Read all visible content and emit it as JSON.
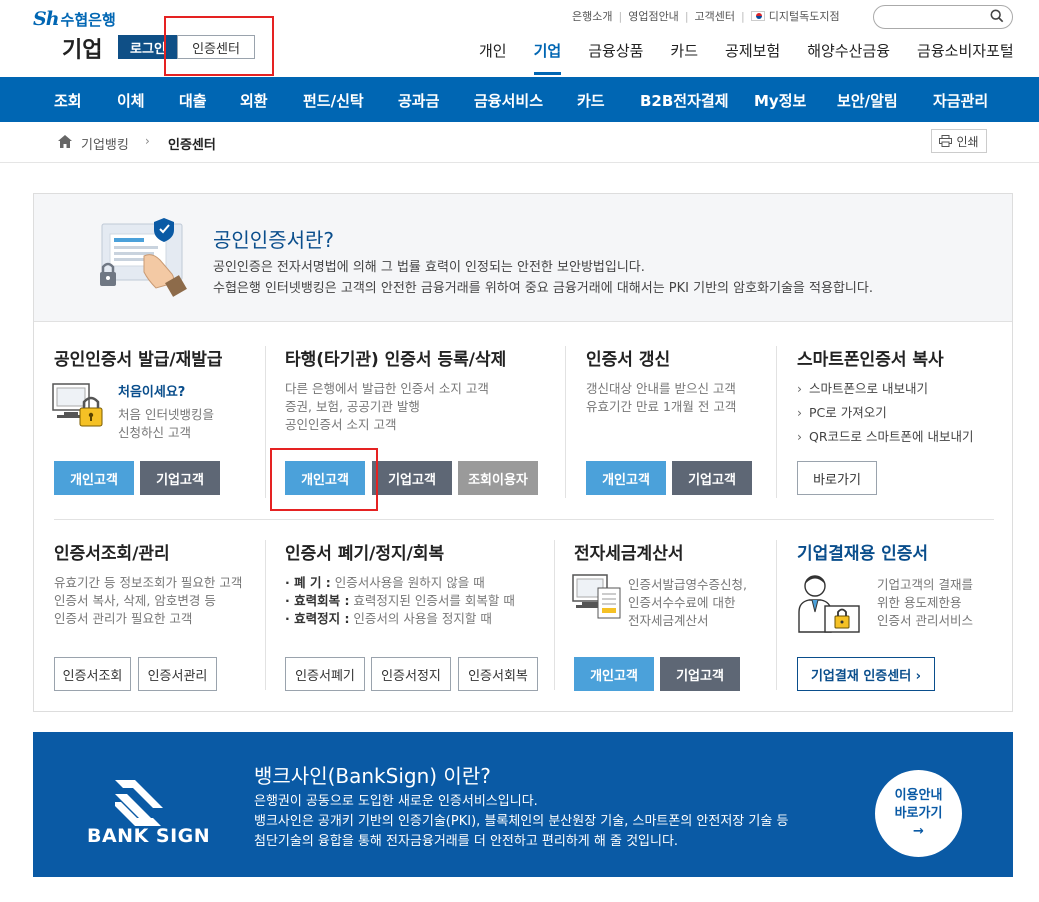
{
  "header": {
    "logo_sh": "Sh",
    "logo_name": "수협은행",
    "section": "기업",
    "login_label": "로그인",
    "cert_center_label": "인증센터",
    "util_links": [
      "은행소개",
      "영업점안내",
      "고객센터",
      "디지털독도지점"
    ],
    "search_placeholder": "",
    "gnb": [
      "개인",
      "기업",
      "금융상품",
      "카드",
      "공제보험",
      "해양수산금융",
      "금융소비자포털"
    ],
    "gnb_active": "기업"
  },
  "subnav": [
    "조회",
    "이체",
    "대출",
    "외환",
    "펀드/신탁",
    "공과금",
    "금융서비스",
    "카드",
    "B2B전자결제",
    "My정보",
    "보안/알림",
    "자금관리"
  ],
  "breadcrumb": {
    "home": "기업뱅킹",
    "current": "인증센터",
    "print_label": "인쇄"
  },
  "intro": {
    "title": "공인인증서란?",
    "line1": "공인인증은 전자서명법에 의해 그 법률 효력이 인정되는 안전한 보안방법입니다.",
    "line2": "수협은행 인터넷뱅킹은 고객의 안전한 금융거래를 위하여 중요 금융거래에 대해서는 PKI 기반의 암호화기술을 적용합니다."
  },
  "sections": {
    "issue": {
      "title": "공인인증서 발급/재발급",
      "first_time": "처음이세요?",
      "desc1": "처음 인터넷뱅킹을",
      "desc2": "신청하신 고객",
      "btn_personal": "개인고객",
      "btn_corp": "기업고객"
    },
    "other_bank": {
      "title": "타행(타기관) 인증서 등록/삭제",
      "desc1": "다른 은행에서 발급한 인증서 소지 고객",
      "desc2": "증권, 보험, 공공기관 발행",
      "desc3": "공인인증서 소지 고객",
      "btn_personal": "개인고객",
      "btn_corp": "기업고객",
      "btn_inquiry": "조회이용자"
    },
    "renew": {
      "title": "인증서 갱신",
      "desc1": "갱신대상 안내를 받으신 고객",
      "desc2": "유효기간 만료 1개월 전 고객",
      "btn_personal": "개인고객",
      "btn_corp": "기업고객"
    },
    "smartphone": {
      "title": "스마트폰인증서 복사",
      "items": [
        "스마트폰으로 내보내기",
        "PC로 가져오기",
        "QR코드로 스마트폰에 내보내기"
      ],
      "btn_go": "바로가기"
    },
    "manage": {
      "title": "인증서조회/관리",
      "desc1": "유효기간 등 정보조회가 필요한 고객",
      "desc2": "인증서 복사, 삭제, 암호변경 등",
      "desc3": "인증서 관리가 필요한 고객",
      "btn_inquiry": "인증서조회",
      "btn_manage": "인증서관리"
    },
    "revoke": {
      "title": "인증서 폐기/정지/회복",
      "defs": [
        {
          "term": "· 폐      기 :",
          "desc": " 인증서사용을 원하지 않을 때"
        },
        {
          "term": "· 효력회복 :",
          "desc": " 효력정지된 인증서를 회복할 때"
        },
        {
          "term": "· 효력정지 :",
          "desc": " 인증서의 사용을 정지할 때"
        }
      ],
      "btn_revoke": "인증서폐기",
      "btn_suspend": "인증서정지",
      "btn_restore": "인증서회복"
    },
    "tax": {
      "title": "전자세금계산서",
      "desc1": "인증서발급영수증신청,",
      "desc2": "인증서수수료에 대한",
      "desc3": "전자세금계산서",
      "btn_personal": "개인고객",
      "btn_corp": "기업고객"
    },
    "corp_pay": {
      "title": "기업결재용 인증서",
      "desc1": "기업고객의 결재를",
      "desc2": "위한 용도제한용",
      "desc3": "인증서 관리서비스",
      "btn_center": "기업결재 인증센터 ›"
    }
  },
  "banner": {
    "logo_text": "BANK SIGN",
    "title": "뱅크사인(BankSign) 이란?",
    "line1": "은행권이 공동으로 도입한 새로운 인증서비스입니다.",
    "line2": "뱅크사인은 공개키 기반의 인증기술(PKI), 블록체인의 분산원장 기술, 스마트폰의 안전저장 기술 등",
    "line3": "첨단기술의 융합을 통해 전자금융거래를 더 안전하고 편리하게 해 줄 것입니다.",
    "cta_line1": "이용안내",
    "cta_line2": "바로가기",
    "cta_arrow": "→"
  },
  "colors": {
    "brand_blue": "#0066b3",
    "dark_navy": "#0f4f86",
    "button_light_blue": "#4ba1da",
    "button_gray": "#5e6775",
    "highlight_red": "#e52222"
  }
}
